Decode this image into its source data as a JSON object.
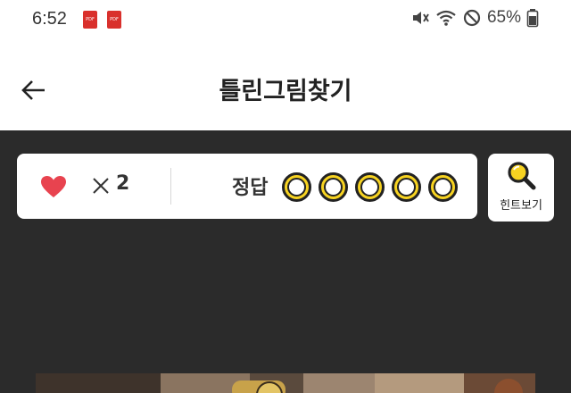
{
  "status_bar": {
    "time": "6:52",
    "notification_icons": [
      "pdf-icon",
      "pdf-icon"
    ],
    "system_icons": [
      "vibrate-mute-icon",
      "wifi-icon",
      "do-not-disturb-icon",
      "battery-icon"
    ],
    "battery": "65%"
  },
  "app_bar": {
    "back_icon": "arrow-left-icon",
    "title": "틀린그림찾기"
  },
  "game": {
    "lives_icon": "heart-icon",
    "lives_count": "2",
    "answer_label": "정답",
    "answers_total": 5,
    "answers_found": 0,
    "hint_label": "힌트보기",
    "hint_icon": "magnifier-icon"
  },
  "colors": {
    "accent_yellow": "#f7d321",
    "heart_red": "#e8434f",
    "background_dark": "#2b2b2b"
  }
}
